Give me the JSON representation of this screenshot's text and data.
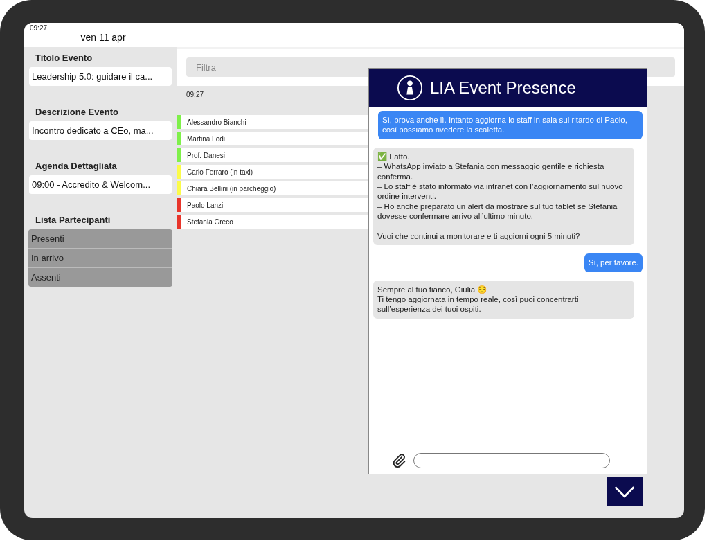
{
  "status_bar": {
    "time": "09:27",
    "date": "ven 11 apr"
  },
  "sidebar": {
    "sections": [
      {
        "kind": "field",
        "title": "Titolo Evento",
        "value": "Leadership 5.0: guidare il ca..."
      },
      {
        "kind": "field",
        "title": "Descrizione Evento",
        "value": "Incontro dedicato a CEo, ma..."
      },
      {
        "kind": "field",
        "title": "Agenda Dettagliata",
        "value": "09:00 - Accredito & Welcom..."
      },
      {
        "kind": "list",
        "title": "Lista Partecipanti",
        "items": [
          "Presenti",
          "In arrivo",
          "Assenti"
        ]
      }
    ]
  },
  "filter": {
    "placeholder": "Filtra"
  },
  "updated_time": "09:27",
  "participants": [
    {
      "name": "Alessandro Bianchi",
      "color": "#7ff04a"
    },
    {
      "name": "Martina Lodi",
      "color": "#7ff04a"
    },
    {
      "name": "Prof. Danesi",
      "color": "#7ff04a"
    },
    {
      "name": "Carlo Ferraro (in taxi)",
      "color": "#fbfb4a"
    },
    {
      "name": "Chiara Bellini (in parcheggio)",
      "color": "#fbfb4a"
    },
    {
      "name": "Paolo Lanzi",
      "color": "#e8352b"
    },
    {
      "name": "Stefania Greco",
      "color": "#e8352b"
    }
  ],
  "chat": {
    "title": "LIA Event Presence",
    "messages": [
      {
        "kind": "user",
        "text": "Sì, prova anche lì. Intanto aggiorna lo staff in sala sul ritardo di Paolo, così possiamo rivedere la scaletta."
      },
      {
        "kind": "assistant",
        "text": "✅ Fatto.\n– WhatsApp inviato a Stefania con messaggio gentile e richiesta conferma.\n– Lo staff è stato informato via intranet con l’aggiornamento sul nuovo ordine interventi.\n– Ho anche preparato un alert da mostrare sul tuo tablet se Stefania dovesse confermare arrivo all’ultimo minuto.\n\nVuoi che continui a monitorare e ti aggiorni ogni 5 minuti?"
      },
      {
        "kind": "user",
        "text": "Sì, per favore."
      },
      {
        "kind": "assistant",
        "text": "Sempre al tuo fianco, Giulia 😌\nTi tengo aggiornata in tempo reale, così puoi concentrarti sull’esperienza dei tuoi ospiti."
      }
    ]
  }
}
